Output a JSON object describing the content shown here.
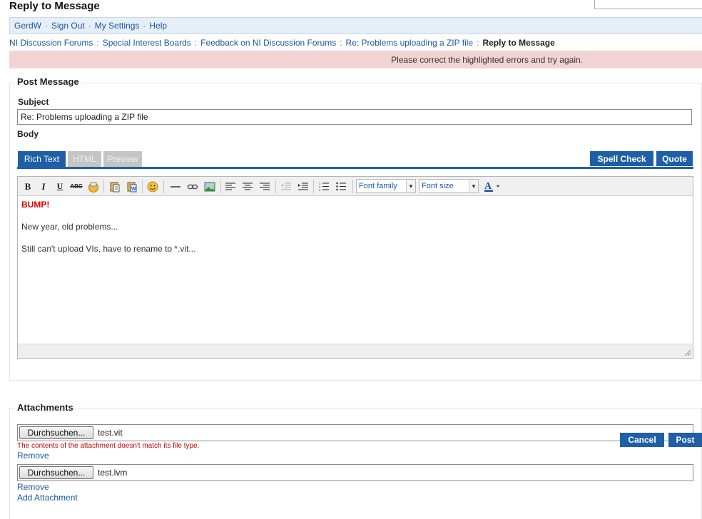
{
  "page": {
    "title": "Reply to Message"
  },
  "userbar": {
    "items": [
      "GerdW",
      "Sign Out",
      "My Settings",
      "Help"
    ]
  },
  "breadcrumb": {
    "items": [
      "NI Discussion Forums",
      "Special Interest Boards",
      "Feedback on NI Discussion Forums",
      "Re: Problems uploading a ZIP file"
    ],
    "current": "Reply to Message"
  },
  "error_banner": "Please correct the highlighted errors and try again.",
  "post_message": {
    "legend": "Post Message",
    "subject_label": "Subject",
    "subject_value": "Re: Problems uploading a ZIP file",
    "body_label": "Body",
    "tabs": [
      "Rich Text",
      "HTML",
      "Preview"
    ],
    "spell_check": "Spell Check",
    "quote": "Quote",
    "font_family": "Font family",
    "font_size": "Font size",
    "content": [
      "BUMP!",
      "New year, old problems...",
      "Still can't upload VIs, have to rename to *.vit..."
    ]
  },
  "attachments": {
    "legend": "Attachments",
    "browse_label": "Durchsuchen...",
    "files": [
      {
        "name": "test.vit",
        "remove": "Remove"
      },
      {
        "name": "test.lvm",
        "remove": "Remove"
      }
    ],
    "error": "The contents of the attachment doesn't match its file type.",
    "add": "Add Attachment"
  },
  "actions": {
    "cancel": "Cancel",
    "post": "Post"
  }
}
